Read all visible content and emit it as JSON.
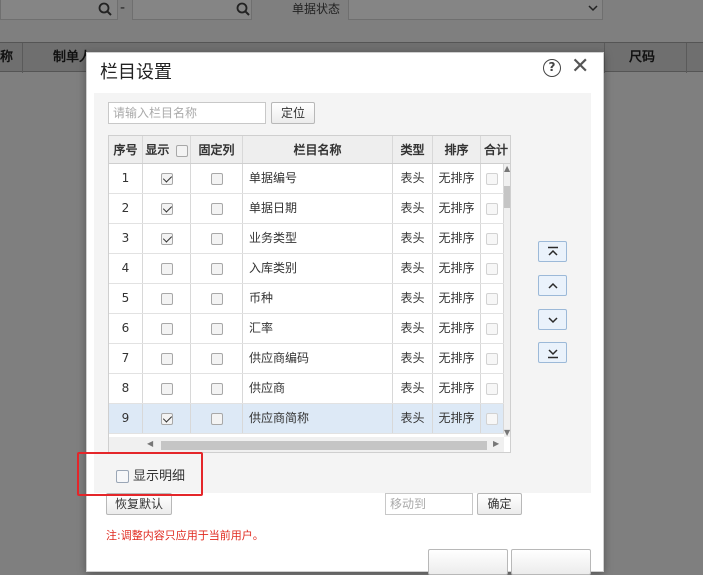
{
  "background": {
    "status_label": "单据状态",
    "dash": "-",
    "columns": [
      "称",
      "制单人",
      "尺码"
    ]
  },
  "dialog": {
    "title": "栏目设置",
    "search_placeholder": "请输入栏目名称",
    "locate_label": "定位",
    "headers": {
      "seq": "序号",
      "show": "显示",
      "fixed": "固定列",
      "name": "栏目名称",
      "type": "类型",
      "sort": "排序",
      "total": "合计"
    },
    "rows": [
      {
        "seq": "1",
        "show": true,
        "name": "单据编号",
        "type": "表头",
        "sort": "无排序"
      },
      {
        "seq": "2",
        "show": true,
        "name": "单据日期",
        "type": "表头",
        "sort": "无排序"
      },
      {
        "seq": "3",
        "show": true,
        "name": "业务类型",
        "type": "表头",
        "sort": "无排序"
      },
      {
        "seq": "4",
        "show": false,
        "name": "入库类别",
        "type": "表头",
        "sort": "无排序"
      },
      {
        "seq": "5",
        "show": false,
        "name": "币种",
        "type": "表头",
        "sort": "无排序"
      },
      {
        "seq": "6",
        "show": false,
        "name": "汇率",
        "type": "表头",
        "sort": "无排序"
      },
      {
        "seq": "7",
        "show": false,
        "name": "供应商编码",
        "type": "表头",
        "sort": "无排序"
      },
      {
        "seq": "8",
        "show": false,
        "name": "供应商",
        "type": "表头",
        "sort": "无排序"
      },
      {
        "seq": "9",
        "show": true,
        "name": "供应商简称",
        "type": "表头",
        "sort": "无排序"
      }
    ],
    "show_detail_label": "显示明细",
    "restore_label": "恢复默认",
    "move_to_placeholder": "移动到",
    "confirm_label": "确定",
    "note": "注:调整内容只应用于当前用户。"
  }
}
